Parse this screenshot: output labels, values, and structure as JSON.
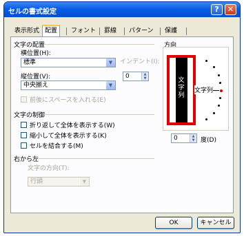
{
  "window": {
    "title": "セルの書式設定",
    "help_label": "?",
    "close_label": "✕"
  },
  "tabs": [
    "表示形式",
    "配置",
    "フォント",
    "罫線",
    "パターン",
    "保護"
  ],
  "active_tab": "配置",
  "alignment": {
    "heading": "文字の配置",
    "horizontal_label": "横位置(H):",
    "horizontal_value": "標準",
    "indent_label": "インデント(I):",
    "vertical_label": "縦位置(V):",
    "vertical_value": "中央揃え",
    "indent_value": "0",
    "distributed_label": "前後にスペースを入れる(E)"
  },
  "text_control": {
    "heading": "文字の制御",
    "wrap_label": "折り返して全体を表示する(W)",
    "shrink_label": "縮小して全体を表示する(K)",
    "merge_label": "セルを結合する(M)"
  },
  "rtl": {
    "heading": "右から左",
    "direction_label": "文字の方向(T):",
    "direction_value": "行頭"
  },
  "orientation": {
    "heading": "方向",
    "vertical_text": "文字列",
    "horizontal_text": "文字列",
    "degrees_value": "0",
    "degrees_label": "度(D)"
  },
  "buttons": {
    "ok": "OK",
    "cancel": "キャンセル"
  },
  "colors": {
    "title_bar": "#0a5ce8",
    "highlight": "#e00000",
    "dialog": "#ece9d8"
  }
}
